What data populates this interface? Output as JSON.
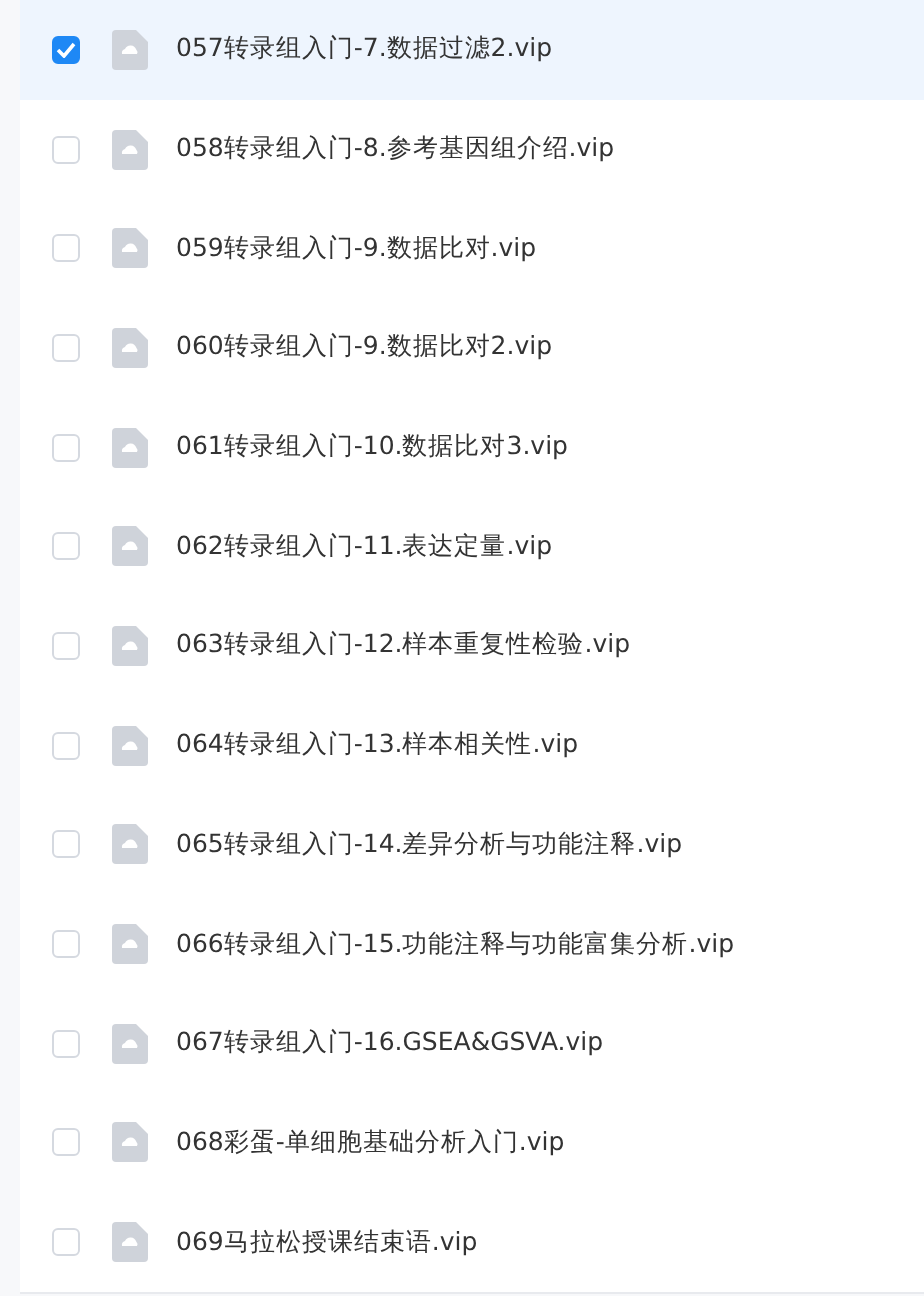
{
  "files": [
    {
      "name": "057转录组入门-7.数据过滤2.vip",
      "checked": true
    },
    {
      "name": "058转录组入门-8.参考基因组介绍.vip",
      "checked": false
    },
    {
      "name": "059转录组入门-9.数据比对.vip",
      "checked": false
    },
    {
      "name": "060转录组入门-9.数据比对2.vip",
      "checked": false
    },
    {
      "name": "061转录组入门-10.数据比对3.vip",
      "checked": false
    },
    {
      "name": "062转录组入门-11.表达定量.vip",
      "checked": false
    },
    {
      "name": "063转录组入门-12.样本重复性检验.vip",
      "checked": false
    },
    {
      "name": "064转录组入门-13.样本相关性.vip",
      "checked": false
    },
    {
      "name": "065转录组入门-14.差异分析与功能注释.vip",
      "checked": false
    },
    {
      "name": "066转录组入门-15.功能注释与功能富集分析.vip",
      "checked": false
    },
    {
      "name": "067转录组入门-16.GSEA&GSVA.vip",
      "checked": false
    },
    {
      "name": "068彩蛋-单细胞基础分析入门.vip",
      "checked": false
    },
    {
      "name": "069马拉松授课结束语.vip",
      "checked": false
    }
  ]
}
